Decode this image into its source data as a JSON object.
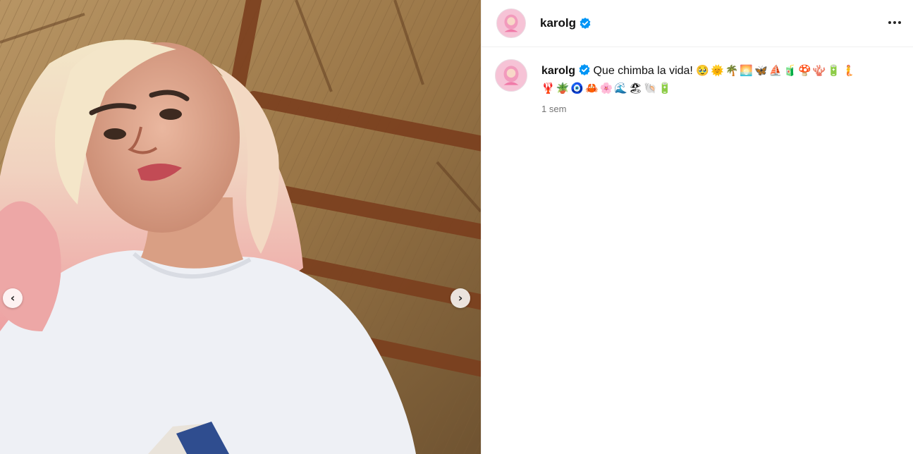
{
  "post": {
    "username": "karolg",
    "verified": true,
    "caption_text": "Que chimba la vida!",
    "caption_emojis_line1": "🥹🌞🌴🌅🦋⛵🧃🍄🪸🔋🧜",
    "caption_emojis_line2": "🦞🪴🧿🦀🌸🌊🏖🐚🔋",
    "timestamp": "1 sem"
  },
  "icons": {
    "prev": "chevron-left-icon",
    "next": "chevron-right-icon",
    "more": "more-horizontal-icon",
    "verified": "verified-badge-icon"
  },
  "colors": {
    "verified_blue": "#0095f6",
    "secondary_text": "#737373"
  }
}
